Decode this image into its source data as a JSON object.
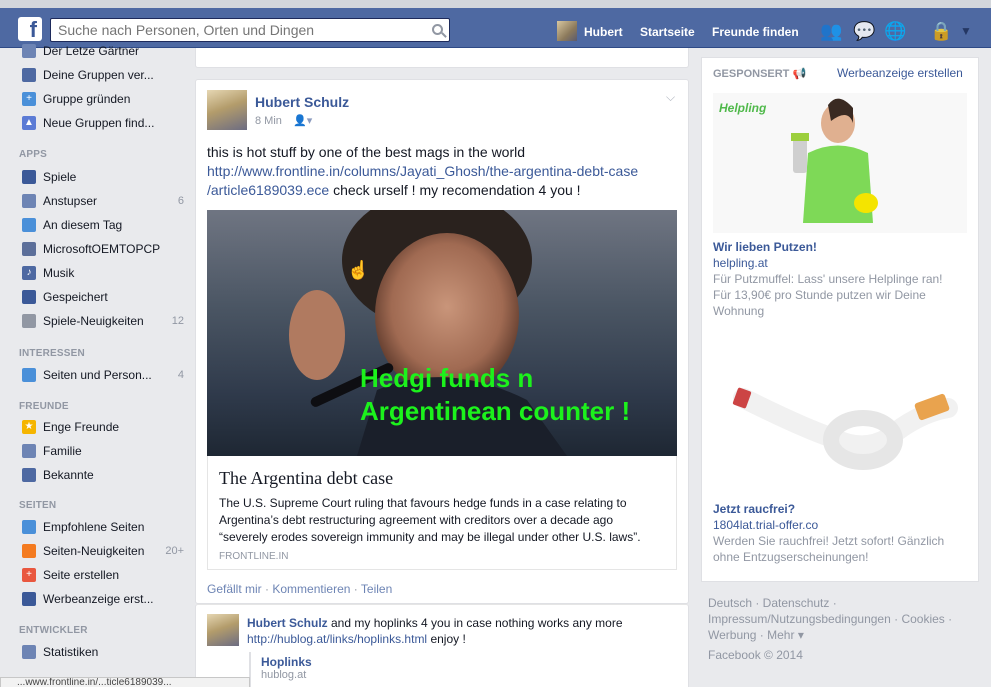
{
  "topbar": {
    "search_placeholder": "Suche nach Personen, Orten und Dingen",
    "user_name": "Hubert",
    "home": "Startseite",
    "find_friends": "Freunde finden"
  },
  "leftnav": {
    "top_items": [
      {
        "label": "Der Letze Gärtner"
      },
      {
        "label": "Deine Gruppen ver..."
      },
      {
        "label": "Gruppe gründen"
      },
      {
        "label": "Neue Gruppen find..."
      }
    ],
    "apps_header": "APPS",
    "apps": [
      {
        "label": "Spiele",
        "count": ""
      },
      {
        "label": "Anstupser",
        "count": "6"
      },
      {
        "label": "An diesem Tag",
        "count": ""
      },
      {
        "label": "MicrosoftOEMTOPCP",
        "count": ""
      },
      {
        "label": "Musik",
        "count": ""
      },
      {
        "label": "Gespeichert",
        "count": ""
      },
      {
        "label": "Spiele-Neuigkeiten",
        "count": "12"
      }
    ],
    "interests_header": "INTERESSEN",
    "interests": [
      {
        "label": "Seiten und Person...",
        "count": "4"
      }
    ],
    "friends_header": "FREUNDE",
    "friends": [
      {
        "label": "Enge Freunde"
      },
      {
        "label": "Familie"
      },
      {
        "label": "Bekannte"
      }
    ],
    "pages_header": "SEITEN",
    "pages": [
      {
        "label": "Empfohlene Seiten",
        "count": ""
      },
      {
        "label": "Seiten-Neuigkeiten",
        "count": "20+"
      },
      {
        "label": "Seite erstellen",
        "count": ""
      },
      {
        "label": "Werbeanzeige erst...",
        "count": ""
      }
    ],
    "dev_header": "ENTWICKLER",
    "dev": [
      {
        "label": "Statistiken"
      }
    ]
  },
  "post": {
    "author": "Hubert Schulz",
    "time": "8 Min",
    "text_line1": "this is hot stuff by one of the best mags in the world",
    "link_line1": "http://www.frontline.in/columns/Jayati_Ghosh/the-argentina-debt-case",
    "link_line2": "/article6189039.ece",
    "text_after_link": " check urself ! my recomendation 4 you !",
    "overlay_line1": "Hedgi funds n",
    "overlay_line2": "Argentinean counter !",
    "link_title": "The Argentina debt case",
    "link_desc": "The U.S. Supreme Court ruling that favours hedge funds in a case relating to Argentina’s debt restructuring agreement with creditors over a decade ago “severely erodes sovereign immunity and may be illegal under other U.S. laws”.",
    "link_source": "FRONTLINE.IN",
    "like": "Gefällt mir",
    "comment": "Kommentieren",
    "share": "Teilen"
  },
  "post2": {
    "author": "Hubert Schulz",
    "text": " and my hoplinks 4 you in case nothing works any more",
    "link": "http://hublog.at/links/hoplinks.html",
    "text_after": " enjoy !",
    "share_title": "Hoplinks",
    "share_domain": "hublog.at"
  },
  "right": {
    "sponsored": "GESPONSERT",
    "create_ad": "Werbeanzeige erstellen",
    "ad1": {
      "brand": "Helpling",
      "title": "Wir lieben Putzen!",
      "domain": "helpling.at",
      "body": "Für Putzmuffel: Lass' unsere Helplinge ran! Für 13,90€ pro Stunde putzen wir Deine Wohnung"
    },
    "ad2": {
      "title": "Jetzt raucfrei?",
      "domain": "1804lat.trial-offer.co",
      "body": "Werden Sie rauchfrei! Jetzt sofort! Gänzlich ohne Entzugserscheinungen!"
    },
    "footer": {
      "l1": "Deutsch · Datenschutz ·",
      "l2": "Impressum/Nutzungsbedingungen · Cookies ·",
      "l3": "Werbung · Mehr ▾",
      "copyright": "Facebook © 2014"
    }
  },
  "statusbar": "...www.frontline.in/...ticle6189039..."
}
